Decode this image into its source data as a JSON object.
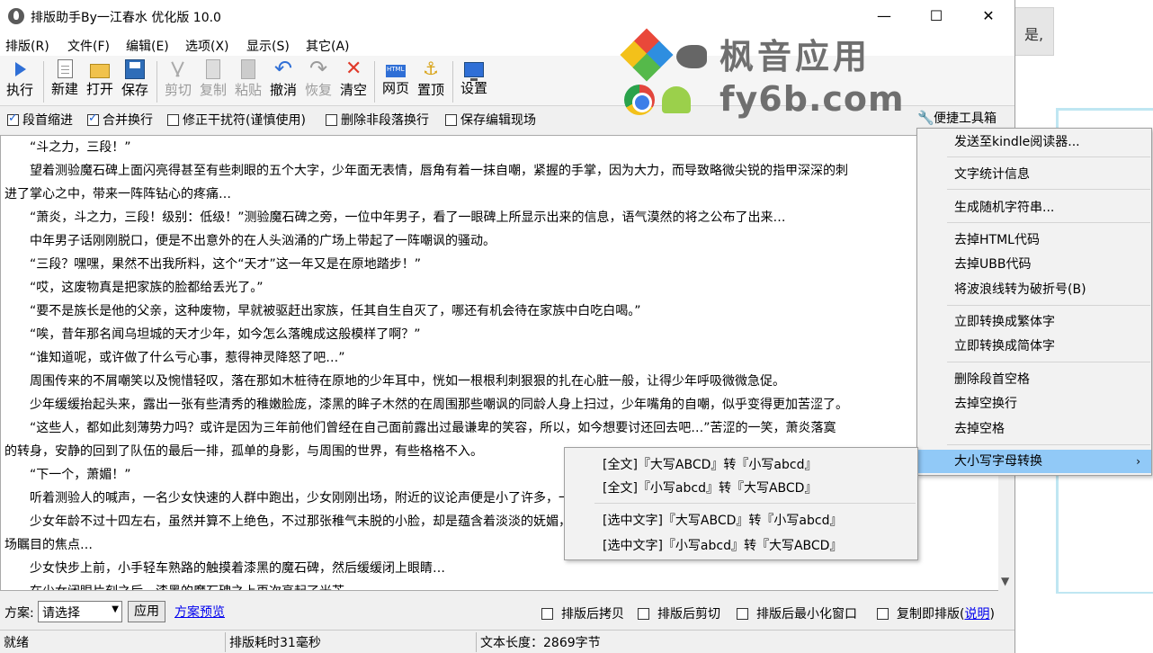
{
  "window": {
    "title": "排版助手By一江春水 优化版 10.0",
    "min_glyph": "—",
    "max_glyph": "☐",
    "close_glyph": "✕"
  },
  "desktop": {
    "card_text": "是,"
  },
  "menu": [
    "排版(R)",
    "文件(F)",
    "编辑(E)",
    "选项(X)",
    "显示(S)",
    "其它(A)"
  ],
  "toolbar": {
    "run": "执行",
    "new": "新建",
    "open": "打开",
    "save": "保存",
    "cut": "剪切",
    "copy": "复制",
    "paste": "粘贴",
    "undo": "撤消",
    "redo": "恢复",
    "clear": "清空",
    "web": "网页",
    "top": "置顶",
    "settings": "设置"
  },
  "watermark": {
    "name": "枫音应用",
    "domain": "fy6b.com"
  },
  "options": [
    {
      "label": "段首缩进",
      "checked": true
    },
    {
      "label": "合并换行",
      "checked": true
    },
    {
      "label": "修正干扰符(谨慎使用)",
      "checked": false
    },
    {
      "label": "删除非段落换行",
      "checked": false
    },
    {
      "label": "保存编辑现场",
      "checked": false
    }
  ],
  "quick_tools": "便捷工具箱",
  "editor_lines": [
    "　　“斗之力，三段！”",
    "　　望着测验魔石碑上面闪亮得甚至有些刺眼的五个大字，少年面无表情，唇角有着一抹自嘲，紧握的手掌，因为大力，而导致略微尖锐的指甲深深的刺",
    "进了掌心之中，带来一阵阵钻心的疼痛…",
    "　　“萧炎，斗之力，三段！级别：低级！”测验魔石碑之旁，一位中年男子，看了一眼碑上所显示出来的信息，语气漠然的将之公布了出来…",
    "　　中年男子话刚刚脱口，便是不出意外的在人头汹涌的广场上带起了一阵嘲讽的骚动。",
    "　　“三段？嘿嘿，果然不出我所料，这个“天才”这一年又是在原地踏步！”",
    "　　“哎，这废物真是把家族的脸都给丢光了。”",
    "　　“要不是族长是他的父亲，这种废物，早就被驱赶出家族，任其自生自灭了，哪还有机会待在家族中白吃白喝。”",
    "　　“唉，昔年那名闻乌坦城的天才少年，如今怎么落魄成这般模样了啊？”",
    "　　“谁知道呢，或许做了什么亏心事，惹得神灵降怒了吧…”",
    "　　周围传来的不屑嘲笑以及惋惜轻叹，落在那如木桩待在原地的少年耳中，恍如一根根利刺狠狠的扎在心脏一般，让得少年呼吸微微急促。",
    "　　少年缓缓抬起头来，露出一张有些清秀的稚嫩脸庞，漆黑的眸子木然的在周围那些嘲讽的同龄人身上扫过，少年嘴角的自嘲，似乎变得更加苦涩了。",
    "　　“这些人，都如此刻薄势力吗？或许是因为三年前他们曾经在自己面前露出过最谦卑的笑容，所以，如今想要讨还回去吧…”苦涩的一笑，萧炎落寞",
    "的转身，安静的回到了队伍的最后一排，孤单的身影，与周围的世界，有些格格不入。",
    "　　“下一个，萧媚！”",
    "　　听着测验人的喊声，一名少女快速的人群中跑出，少女刚刚出场，附近的议论声便是小了许多，一双双略微火热的目光，牢牢的锁定着少女的脸颊…",
    "　　少女年龄不过十四左右，虽然并算不上绝色，不过那张稚气未脱的小脸，却是蕴含着淡淡的妩媚，清纯与妩媚，矛盾的集合，让得她成功的成为了全",
    "场瞩目的焦点…",
    "　　少女快步上前，小手轻车熟路的触摸着漆黑的魔石碑，然后缓缓闭上眼睛…",
    "　　在少女闭眼片刻之后，漆黑的魔石碑之上再次亮起了光芒…"
  ],
  "context_menu": {
    "items": [
      "发送至kindle阅读器...",
      "文字统计信息",
      "生成随机字符串...",
      "去掉HTML代码",
      "去掉UBB代码",
      "将波浪线转为破折号(B)",
      "立即转换成繁体字",
      "立即转换成简体字",
      "删除段首空格",
      "去掉空换行",
      "去掉空格",
      "大小写字母转换"
    ],
    "submenu_arrow": "›"
  },
  "submenu": [
    "[全文]『大写ABCD』转『小写abcd』",
    "[全文]『小写abcd』转『大写ABCD』",
    "[选中文字]『大写ABCD』转『小写abcd』",
    "[选中文字]『小写abcd』转『大写ABCD』"
  ],
  "bottom": {
    "scheme_label": "方案:",
    "scheme_value": "请选择",
    "apply": "应用",
    "preview": "方案预览",
    "checks": [
      "排版后拷贝",
      "排版后剪切",
      "排版后最小化窗口",
      "复制即排版("
    ],
    "help": "说明",
    "close_paren": ")"
  },
  "status": {
    "ready": "就绪",
    "elapsed": "排版耗时31毫秒",
    "length": "文本长度：2869字节"
  }
}
